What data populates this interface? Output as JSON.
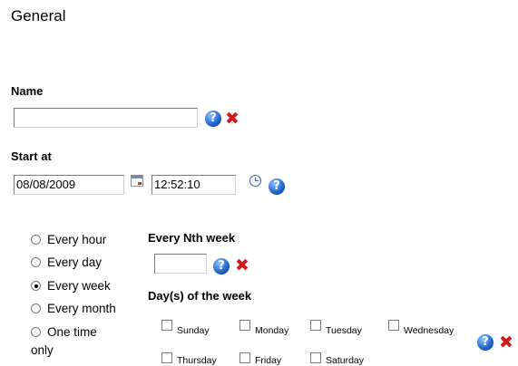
{
  "page_title": "General",
  "name_section": {
    "label": "Name",
    "value": ""
  },
  "start_section": {
    "label": "Start at",
    "date": "08/08/2009",
    "time": "12:52:10"
  },
  "icons": {
    "help": "?",
    "clear": "✖"
  },
  "recurrence": {
    "options": [
      "Every hour",
      "Every day",
      "Every week",
      "Every month",
      "One time",
      "only"
    ],
    "selected": "Every week"
  },
  "nth_week": {
    "label": "Every Nth week",
    "value": ""
  },
  "days_label": "Day(s) of the week",
  "days": [
    "Sunday",
    "Monday",
    "Tuesday",
    "Wednesday",
    "Thursday",
    "Friday",
    "Saturday"
  ]
}
